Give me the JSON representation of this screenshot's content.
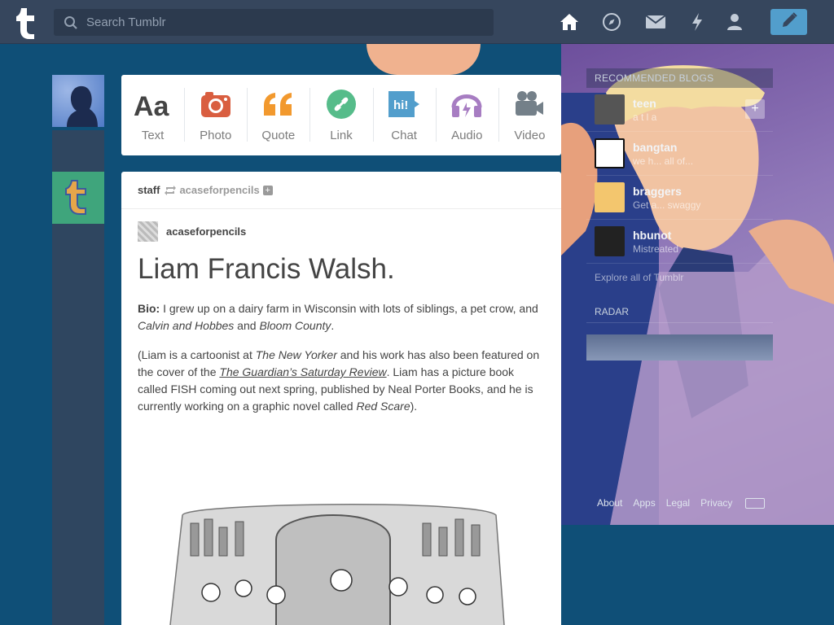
{
  "header": {
    "logo": "tumblr-t-logo",
    "search_placeholder": "Search Tumblr",
    "nav": [
      "home-icon",
      "explore-compass-icon",
      "mail-icon",
      "activity-lightning-icon",
      "account-person-icon"
    ],
    "compose": "pencil-icon"
  },
  "post_types": [
    {
      "label": "Text",
      "icon": "text-aa-icon",
      "color": "#444444"
    },
    {
      "label": "Photo",
      "icon": "camera-icon",
      "color": "#d95e40"
    },
    {
      "label": "Quote",
      "icon": "quote-icon",
      "color": "#f2992e"
    },
    {
      "label": "Link",
      "icon": "link-icon",
      "color": "#56bc8a"
    },
    {
      "label": "Chat",
      "icon": "chat-bubble-icon",
      "color": "#529ecc"
    },
    {
      "label": "Audio",
      "icon": "headphones-icon",
      "color": "#a77dc2"
    },
    {
      "label": "Video",
      "icon": "video-camera-icon",
      "color": "#748089"
    }
  ],
  "post": {
    "reblogger": "staff",
    "source": "acaseforpencils",
    "author": "acaseforpencils",
    "title": "Liam Francis Walsh.",
    "bio_label": "Bio:",
    "bio_text_1": " I grew up on a dairy farm in Wisconsin with lots of siblings, a pet crow, and ",
    "bio_em_1": "Calvin and Hobbes",
    "bio_text_2": " and ",
    "bio_em_2": "Bloom County",
    "bio_text_3": ".",
    "p2_a": "(Liam is a cartoonist at ",
    "p2_em_1": "The New Yorker",
    "p2_b": " and his work has also been featured on the cover of the ",
    "p2_link": "The Guardian’s Saturday Review",
    "p2_c": ". Liam has a picture book called FISH coming out next spring, published by Neal Porter Books, and he is currently working on a graphic novel called ",
    "p2_em_2": "Red Scare",
    "p2_d": ")."
  },
  "sidebar": {
    "title": "RECOMMENDED BLOGS",
    "blogs": [
      {
        "name": "teen",
        "desc": "a t l a"
      },
      {
        "name": "bangtan",
        "desc": "we h... all of..."
      },
      {
        "name": "braggers",
        "desc": "Get a... swaggy"
      },
      {
        "name": "hbunot",
        "desc": "Mistreated"
      }
    ],
    "explore": "Explore all of Tumblr",
    "radar_title": "RADAR"
  },
  "footer": [
    "About",
    "Apps",
    "Legal",
    "Privacy"
  ],
  "colors": {
    "header_bg": "#36465d",
    "page_bg": "#0f4f77",
    "accent": "#529ecc"
  }
}
